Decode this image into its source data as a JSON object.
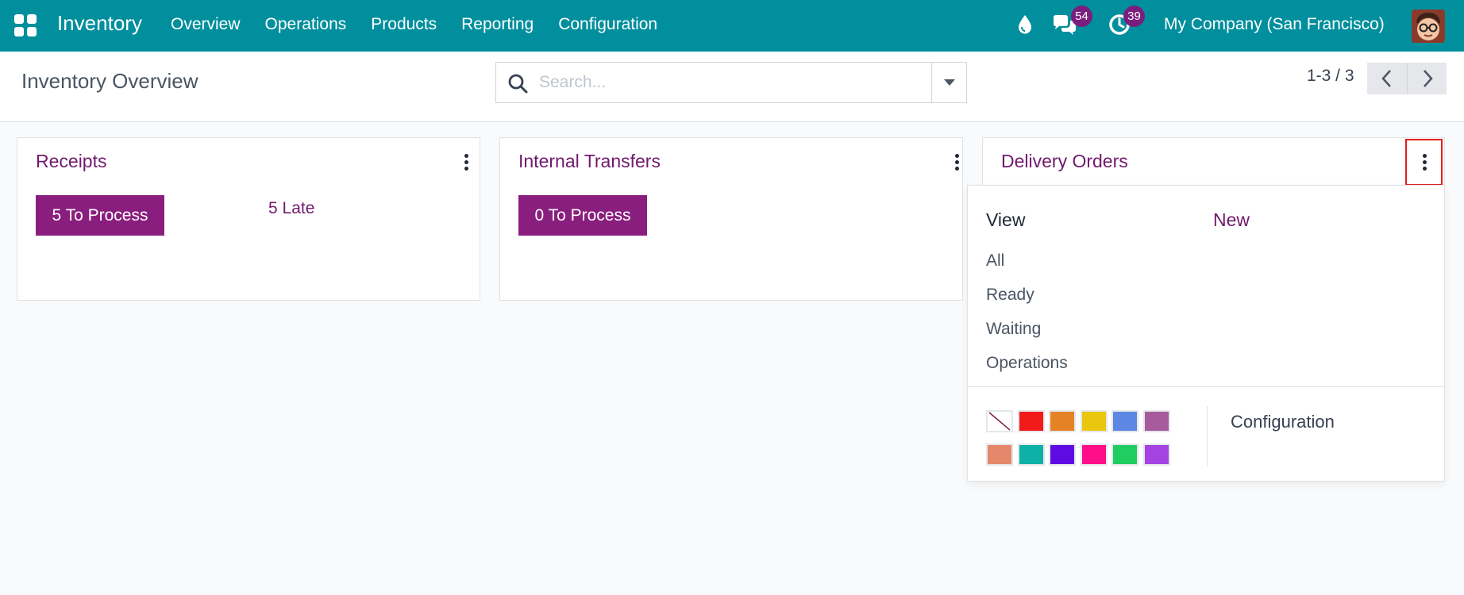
{
  "navbar": {
    "app_name": "Inventory",
    "menu": [
      "Overview",
      "Operations",
      "Products",
      "Reporting",
      "Configuration"
    ],
    "chat_count": "54",
    "activity_count": "39",
    "company": "My Company (San Francisco)",
    "color": "#018f9d"
  },
  "control_panel": {
    "title": "Inventory Overview",
    "search_placeholder": "Search...",
    "pager_value": "1-3 / 3"
  },
  "cards": [
    {
      "title": "Receipts",
      "process_label": "5 To Process",
      "late_label": "5 Late"
    },
    {
      "title": "Internal Transfers",
      "process_label": "0 To Process"
    },
    {
      "title": "Delivery Orders"
    }
  ],
  "dropdown": {
    "view_header": "View",
    "new_label": "New",
    "view_items": [
      "All",
      "Ready",
      "Waiting",
      "Operations"
    ],
    "configuration_label": "Configuration",
    "colors": [
      "none",
      "#f31a1a",
      "#e58324",
      "#eac70f",
      "#5c87e2",
      "#a75b9c",
      "#e4876a",
      "#0eb1a6",
      "#5e0be3",
      "#fe0e89",
      "#20cd61",
      "#a542e2"
    ]
  },
  "accent_color": "#71196c"
}
